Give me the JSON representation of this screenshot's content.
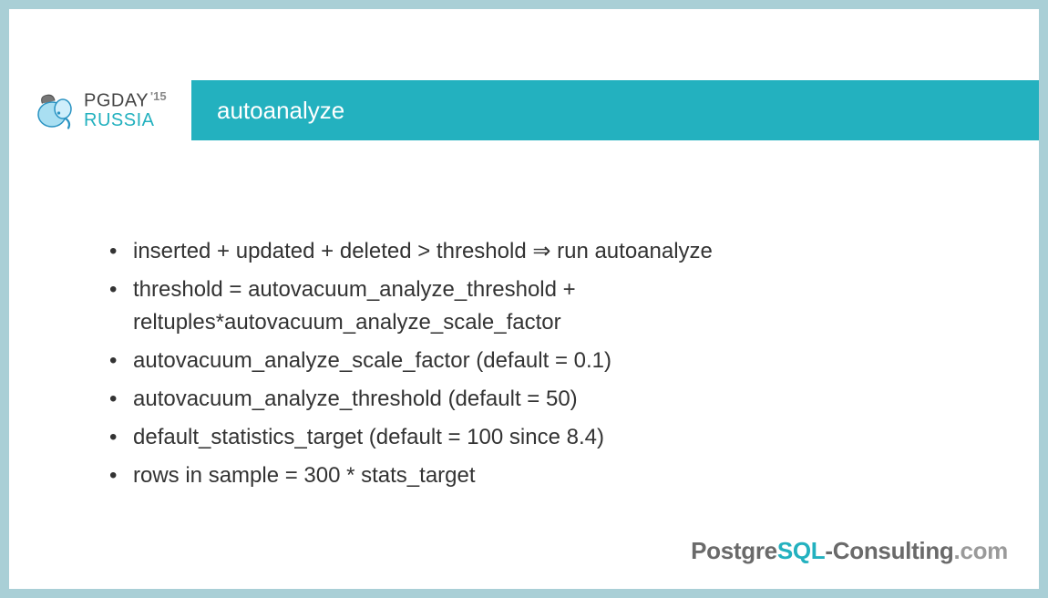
{
  "logo": {
    "line1": "PGDAY",
    "year": "'15",
    "line2": "RUSSIA"
  },
  "title": "autoanalyze",
  "bullets": [
    "inserted + updated + deleted > threshold ⇒ run autoanalyze",
    "threshold = autovacuum_analyze_threshold + reltuples*autovacuum_analyze_scale_factor",
    "autovacuum_analyze_scale_factor (default = 0.1)",
    "autovacuum_analyze_threshold (default = 50)",
    "default_statistics_target (default = 100 since 8.4)",
    "rows in sample = 300 * stats_target"
  ],
  "footer": {
    "part1": "Postgre",
    "part2": "SQL",
    "part3": "-Consulting",
    "part4": ".com"
  }
}
